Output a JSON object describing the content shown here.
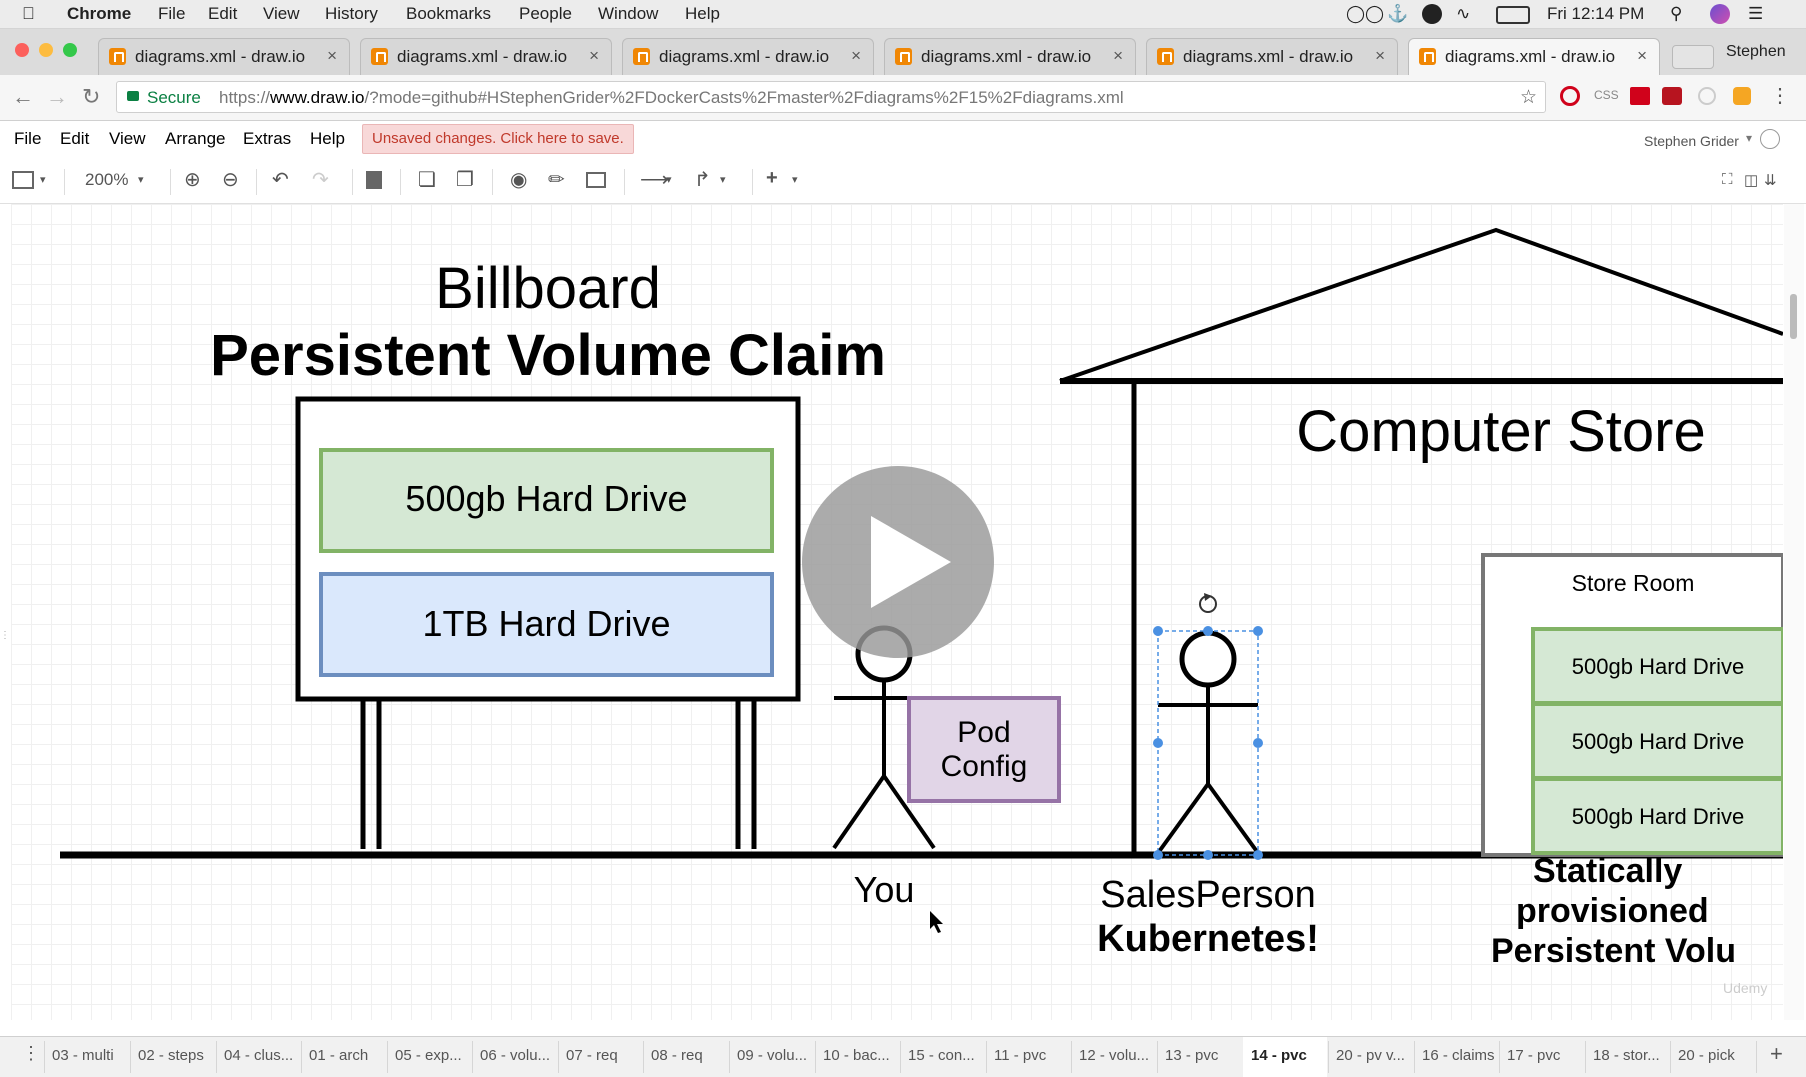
{
  "menubar": {
    "app": "Chrome",
    "items": [
      "File",
      "Edit",
      "View",
      "History",
      "Bookmarks",
      "People",
      "Window",
      "Help"
    ],
    "clock": "Fri 12:14 PM"
  },
  "tabs": [
    {
      "label": "diagrams.xml - draw.io"
    },
    {
      "label": "diagrams.xml - draw.io"
    },
    {
      "label": "diagrams.xml - draw.io"
    },
    {
      "label": "diagrams.xml - draw.io"
    },
    {
      "label": "diagrams.xml - draw.io"
    },
    {
      "label": "diagrams.xml - draw.io"
    }
  ],
  "profile": "Stephen",
  "address": {
    "secure_label": "Secure",
    "url_prefix": "https://",
    "url_host": "www.draw.io",
    "url_rest": "/?mode=github#HStephenGrider%2FDockerCasts%2Fmaster%2Fdiagrams%2F15%2Fdiagrams.xml"
  },
  "drawio_menu": {
    "items": [
      "File",
      "Edit",
      "View",
      "Arrange",
      "Extras",
      "Help"
    ],
    "unsaved": "Unsaved changes. Click here to save.",
    "user": "Stephen Grider"
  },
  "toolbar": {
    "zoom": "200%"
  },
  "diagram": {
    "title_line1": "Billboard",
    "title_line2": "Persistent Volume Claim",
    "drive_500": "500gb Hard Drive",
    "drive_1tb": "1TB Hard Drive",
    "pod_config_line1": "Pod",
    "pod_config_line2": "Config",
    "you_label": "You",
    "store_title": "Computer Store",
    "store_room": "Store Room",
    "store_drives": [
      "500gb Hard Drive",
      "500gb Hard Drive",
      "500gb Hard Drive"
    ],
    "salesperson": "SalesPerson",
    "kubernetes": "Kubernetes!",
    "static_line1": "Statically",
    "static_line2": "provisioned",
    "static_line3": "Persistent Volu",
    "watermark": "Udemy"
  },
  "page_tabs": [
    "03 - multi",
    "02 - steps",
    "04 - clus...",
    "01 - arch",
    "05 - exp...",
    "06 - volu...",
    "07 - req",
    "08 - req",
    "09 - volu...",
    "10 - bac...",
    "15 - con...",
    "11 - pvc",
    "12 - volu...",
    "13 - pvc",
    "14 - pvc",
    "20 - pv v...",
    "16 - claims",
    "17 - pvc",
    "18 - stor...",
    "20 - pick"
  ],
  "active_page": "14 - pvc",
  "colors": {
    "green_fill": "#d5e8d4",
    "green_stroke": "#82b366",
    "blue_fill": "#dae8fc",
    "blue_stroke": "#6c8ebf",
    "purple_fill": "#e1d5e7",
    "purple_stroke": "#9673a6",
    "selection": "#4a90e2"
  }
}
